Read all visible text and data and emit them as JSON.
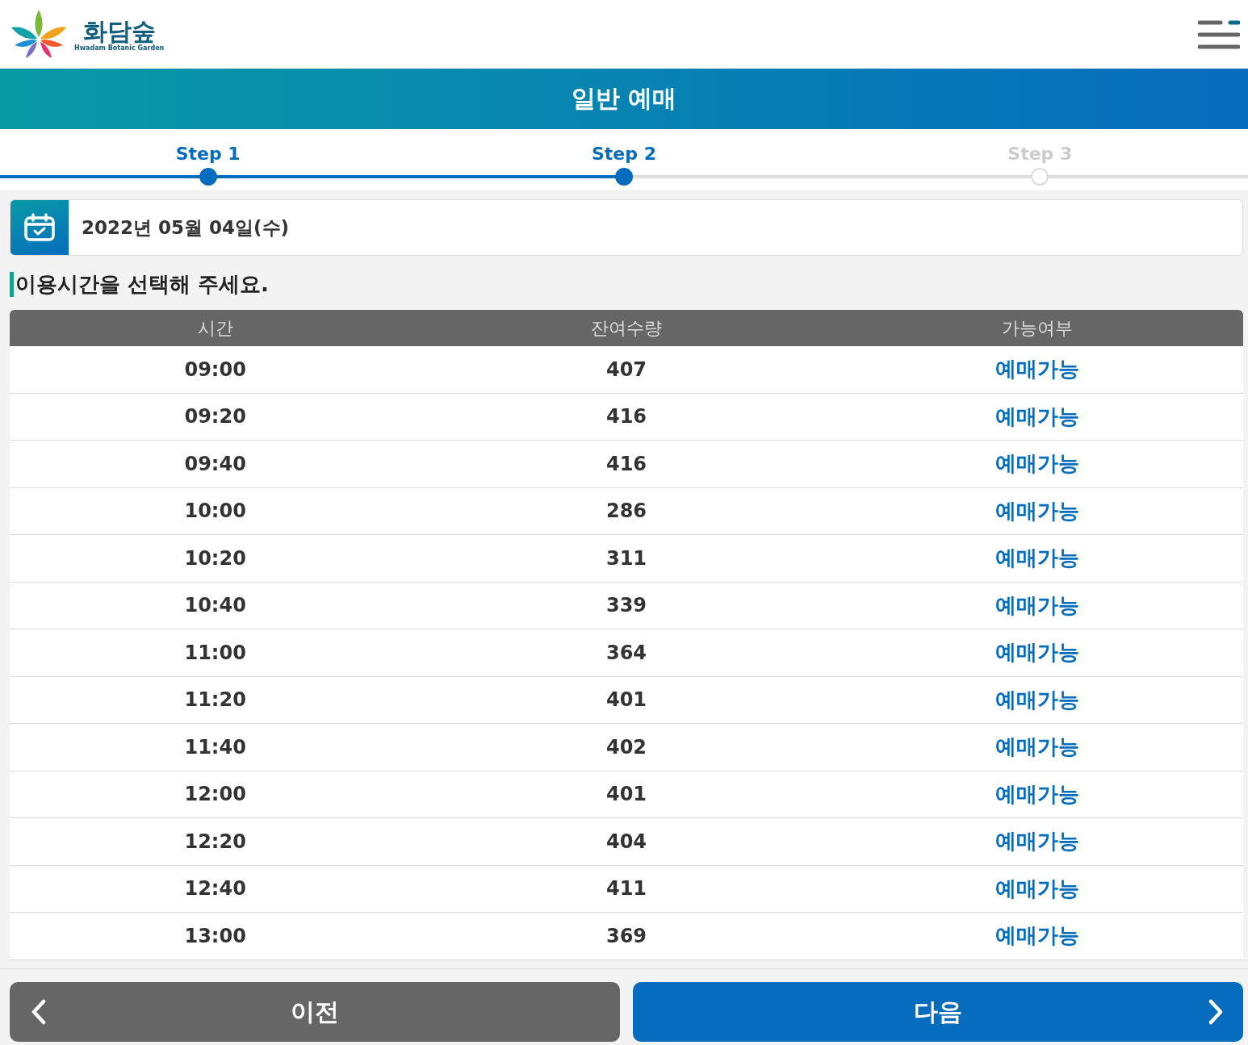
{
  "header": {
    "logo_title": "화담숲",
    "logo_subtitle": "Hwadam Botanic Garden"
  },
  "banner": {
    "title": "일반 예매"
  },
  "steps": [
    {
      "label": "Step 1",
      "reached": true
    },
    {
      "label": "Step 2",
      "reached": true
    },
    {
      "label": "Step 3",
      "reached": false
    }
  ],
  "date": {
    "value": "2022년 05월 04일(수)"
  },
  "instruction": "이용시간을 선택해 주세요.",
  "table": {
    "columns": [
      "시간",
      "잔여수량",
      "가능여부"
    ],
    "rows": [
      {
        "time": "09:00",
        "remaining": "407",
        "status": "예매가능"
      },
      {
        "time": "09:20",
        "remaining": "416",
        "status": "예매가능"
      },
      {
        "time": "09:40",
        "remaining": "416",
        "status": "예매가능"
      },
      {
        "time": "10:00",
        "remaining": "286",
        "status": "예매가능"
      },
      {
        "time": "10:20",
        "remaining": "311",
        "status": "예매가능"
      },
      {
        "time": "10:40",
        "remaining": "339",
        "status": "예매가능"
      },
      {
        "time": "11:00",
        "remaining": "364",
        "status": "예매가능"
      },
      {
        "time": "11:20",
        "remaining": "401",
        "status": "예매가능"
      },
      {
        "time": "11:40",
        "remaining": "402",
        "status": "예매가능"
      },
      {
        "time": "12:00",
        "remaining": "401",
        "status": "예매가능"
      },
      {
        "time": "12:20",
        "remaining": "404",
        "status": "예매가능"
      },
      {
        "time": "12:40",
        "remaining": "411",
        "status": "예매가능"
      },
      {
        "time": "13:00",
        "remaining": "369",
        "status": "예매가능"
      }
    ]
  },
  "buttons": {
    "prev": "이전",
    "next": "다음"
  }
}
